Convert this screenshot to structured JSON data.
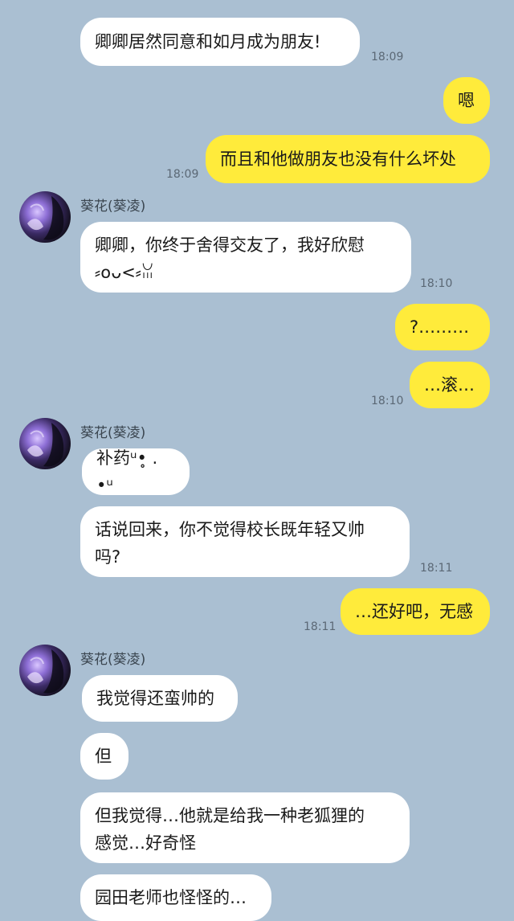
{
  "contact": {
    "name": "葵花(葵凌)"
  },
  "messages": [
    {
      "text": "卿卿居然同意和如月成为朋友!",
      "time": "18:09"
    },
    {
      "text": "嗯"
    },
    {
      "text": "而且和他做朋友也没有什么坏处",
      "time": "18:09"
    },
    {
      "text": "卿卿，你终于舍得交友了，我好欣慰\n⸗໐ᴗ<⸗ꈍ",
      "time": "18:10"
    },
    {
      "text": "?………"
    },
    {
      "text": "…滚…",
      "time": "18:10"
    },
    {
      "text": "补药ᵘ•̥ . •ᵘ"
    },
    {
      "text": "话说回来，你不觉得校长既年轻又帅\n吗?",
      "time": "18:11"
    },
    {
      "text": "…还好吧，无感",
      "time": "18:11"
    },
    {
      "text": "我觉得还蛮帅的"
    },
    {
      "text": "但"
    },
    {
      "text": "但我觉得…他就是给我一种老狐狸的\n感觉…好奇怪"
    },
    {
      "text": "园田老师也怪怪的…"
    }
  ]
}
